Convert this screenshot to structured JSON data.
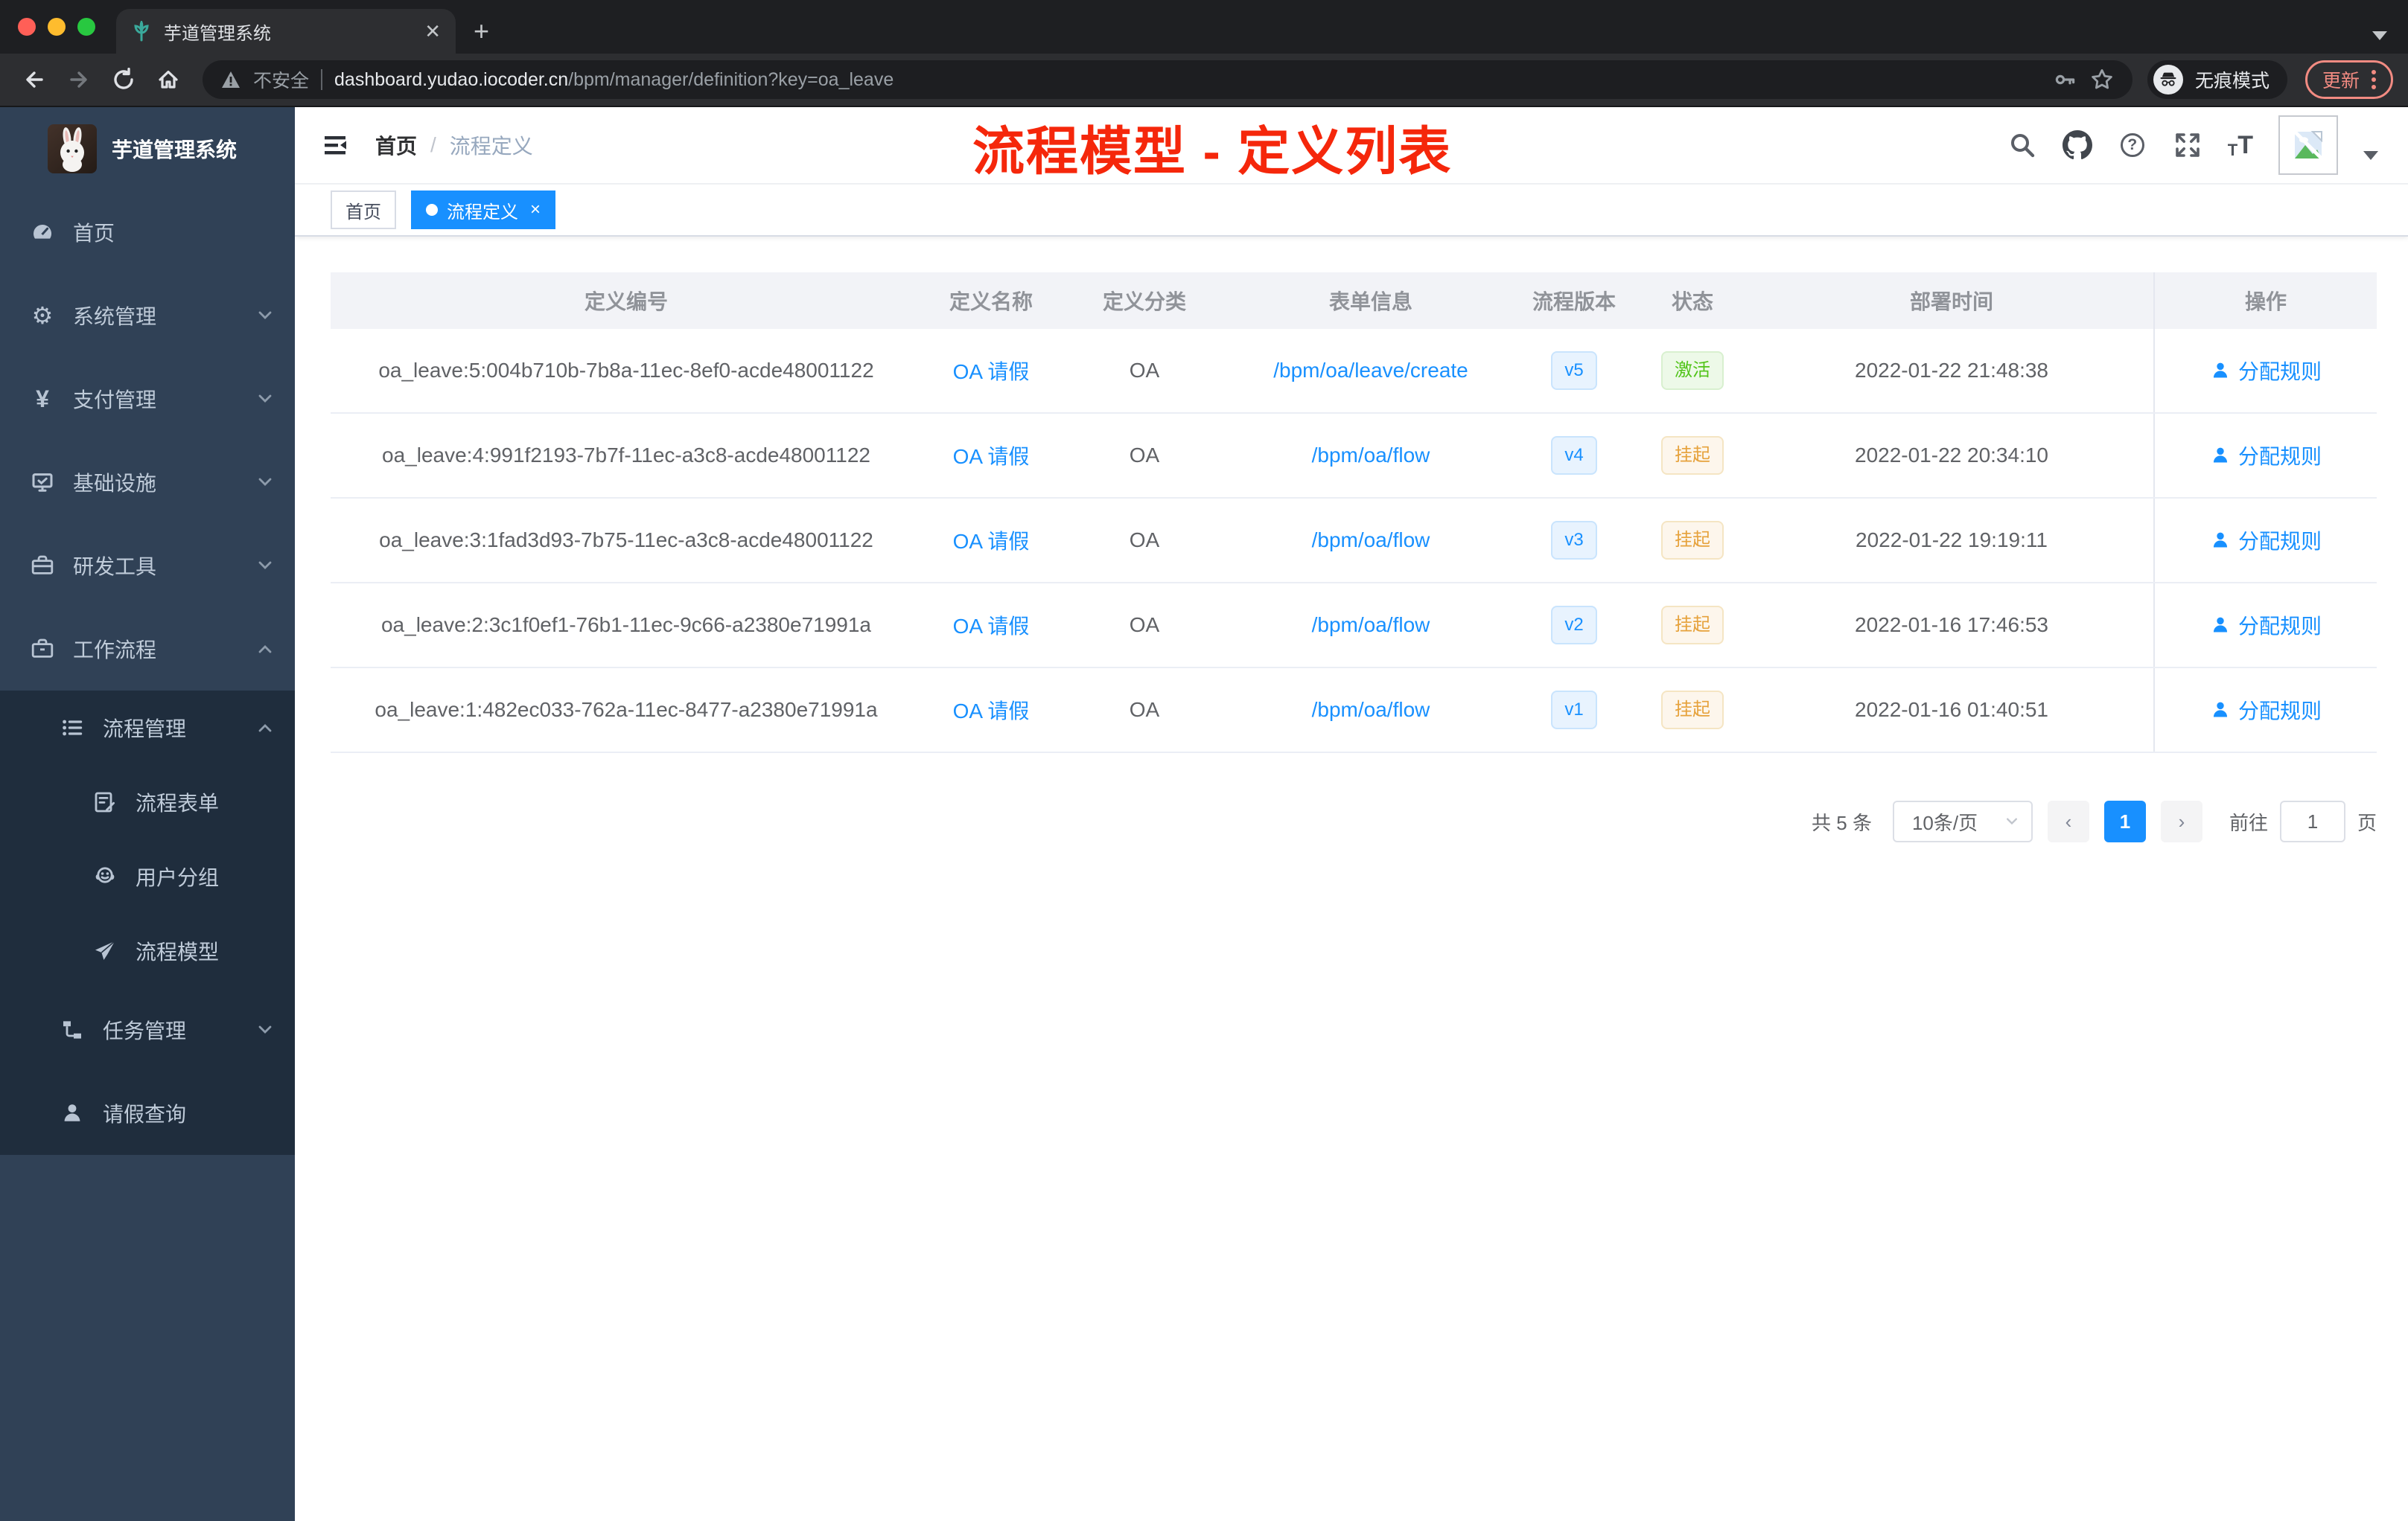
{
  "colors": {
    "accent": "#1890ff",
    "annotation_red": "#f5270b",
    "status_active_green": "#52c41a",
    "status_suspended_orange": "#e6a23c",
    "sidebar_bg": "#304156",
    "sidebar_submenu_bg": "#1f2d3d"
  },
  "browser": {
    "tab_title": "芋道管理系统",
    "security_label": "不安全",
    "url_domain": "dashboard.yudao.iocoder.cn",
    "url_path": "/bpm/manager/definition?key=oa_leave",
    "incognito_label": "无痕模式",
    "update_label": "更新"
  },
  "sidebar": {
    "title": "芋道管理系统",
    "items": [
      {
        "label": "首页",
        "icon": "dashboard-icon"
      },
      {
        "label": "系统管理",
        "icon": "gear-icon",
        "icon_glyph": "⚙"
      },
      {
        "label": "支付管理",
        "icon": "yen-icon",
        "icon_glyph": "¥"
      },
      {
        "label": "基础设施",
        "icon": "monitor-icon"
      },
      {
        "label": "研发工具",
        "icon": "toolbox-icon"
      },
      {
        "label": "工作流程",
        "icon": "briefcase-icon"
      },
      {
        "label": "流程管理",
        "icon": "list-icon"
      },
      {
        "label": "流程表单",
        "icon": "form-icon"
      },
      {
        "label": "用户分组",
        "icon": "people-icon"
      },
      {
        "label": "流程模型",
        "icon": "send-icon"
      },
      {
        "label": "任务管理",
        "icon": "tree-icon"
      },
      {
        "label": "请假查询",
        "icon": "user-icon"
      }
    ]
  },
  "header": {
    "breadcrumb_home": "首页",
    "breadcrumb_sep": "/",
    "breadcrumb_current": "流程定义",
    "annotation": "流程模型 - 定义列表"
  },
  "tags": {
    "home": "首页",
    "active": "流程定义",
    "close": "×"
  },
  "table": {
    "columns": [
      "定义编号",
      "定义名称",
      "定义分类",
      "表单信息",
      "流程版本",
      "状态",
      "部署时间",
      "操作"
    ],
    "action_label": "分配规则",
    "rows": [
      {
        "id": "oa_leave:5:004b710b-7b8a-11ec-8ef0-acde48001122",
        "name": "OA 请假",
        "category": "OA",
        "form": "/bpm/oa/leave/create",
        "version": "v5",
        "status": "激活",
        "time": "2022-01-22 21:48:38",
        "action": "分配规则"
      },
      {
        "id": "oa_leave:4:991f2193-7b7f-11ec-a3c8-acde48001122",
        "name": "OA 请假",
        "category": "OA",
        "form": "/bpm/oa/flow",
        "version": "v4",
        "status": "挂起",
        "time": "2022-01-22 20:34:10",
        "action": "分配规则"
      },
      {
        "id": "oa_leave:3:1fad3d93-7b75-11ec-a3c8-acde48001122",
        "name": "OA 请假",
        "category": "OA",
        "form": "/bpm/oa/flow",
        "version": "v3",
        "status": "挂起",
        "time": "2022-01-22 19:19:11",
        "action": "分配规则"
      },
      {
        "id": "oa_leave:2:3c1f0ef1-76b1-11ec-9c66-a2380e71991a",
        "name": "OA 请假",
        "category": "OA",
        "form": "/bpm/oa/flow",
        "version": "v2",
        "status": "挂起",
        "time": "2022-01-16 17:46:53",
        "action": "分配规则"
      },
      {
        "id": "oa_leave:1:482ec033-762a-11ec-8477-a2380e71991a",
        "name": "OA 请假",
        "category": "OA",
        "form": "/bpm/oa/flow",
        "version": "v1",
        "status": "挂起",
        "time": "2022-01-16 01:40:51",
        "action": "分配规则"
      }
    ]
  },
  "pagination": {
    "total_label": "共 5 条",
    "page_size": "10条/页",
    "prev": "‹",
    "current_page": "1",
    "next": "›",
    "goto_label": "前往",
    "goto_value": "1",
    "page_unit": "页"
  }
}
